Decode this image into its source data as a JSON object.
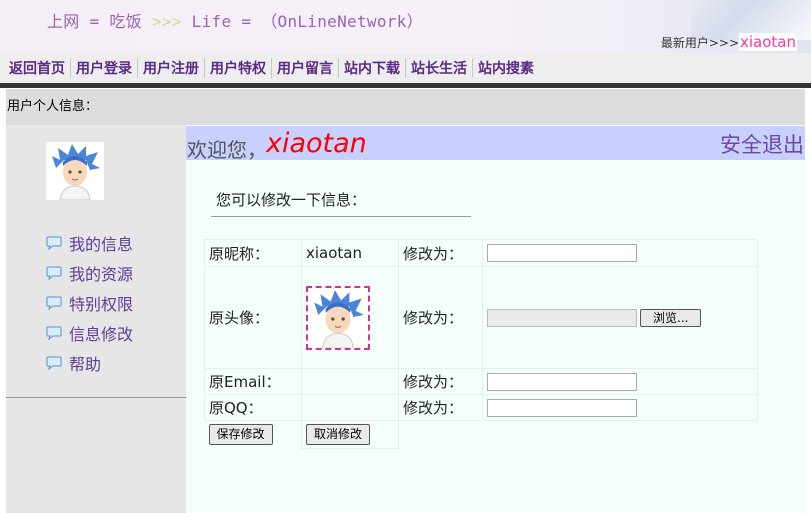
{
  "header": {
    "title_part1": "上网 = 吃饭 ",
    "title_arrows": ">>>",
    "title_part2": " Life = （OnLineNetwork）",
    "latest_label": "最新用户>>>",
    "latest_user": "xiaotan"
  },
  "nav": {
    "items": [
      "返回首页",
      "用户登录",
      "用户注册",
      "用户特权",
      "用户留言",
      "站内下载",
      "站长生活",
      "站内搜素"
    ]
  },
  "infobar": {
    "label": "用户个人信息："
  },
  "sidebar": {
    "items": [
      {
        "label": "我的信息",
        "icon": "speech-bubble-icon"
      },
      {
        "label": "我的资源",
        "icon": "speech-bubble-icon"
      },
      {
        "label": "特别权限",
        "icon": "speech-bubble-icon"
      },
      {
        "label": "信息修改",
        "icon": "speech-bubble-icon"
      },
      {
        "label": "帮助",
        "icon": "speech-bubble-icon"
      }
    ]
  },
  "main": {
    "welcome_prefix": "欢迎您，",
    "welcome_user": "xiaotan",
    "logout": "安全退出",
    "hint": "您可以修改一下信息：",
    "rows": {
      "nickname": {
        "label": "原昵称：",
        "value": "xiaotan",
        "modify": "修改为："
      },
      "avatar": {
        "label": "原头像：",
        "modify": "修改为：",
        "browse": "浏览..."
      },
      "email": {
        "label": "原Email：",
        "modify": "修改为："
      },
      "qq": {
        "label": "原QQ：",
        "modify": "修改为："
      }
    },
    "save": "保存修改",
    "cancel": "取消修改"
  },
  "colors": {
    "accent_purple": "#5a2a86",
    "welcome_bg": "#c7d0ff",
    "welcome_user": "#ff0000",
    "latest_user": "#ff3399"
  }
}
